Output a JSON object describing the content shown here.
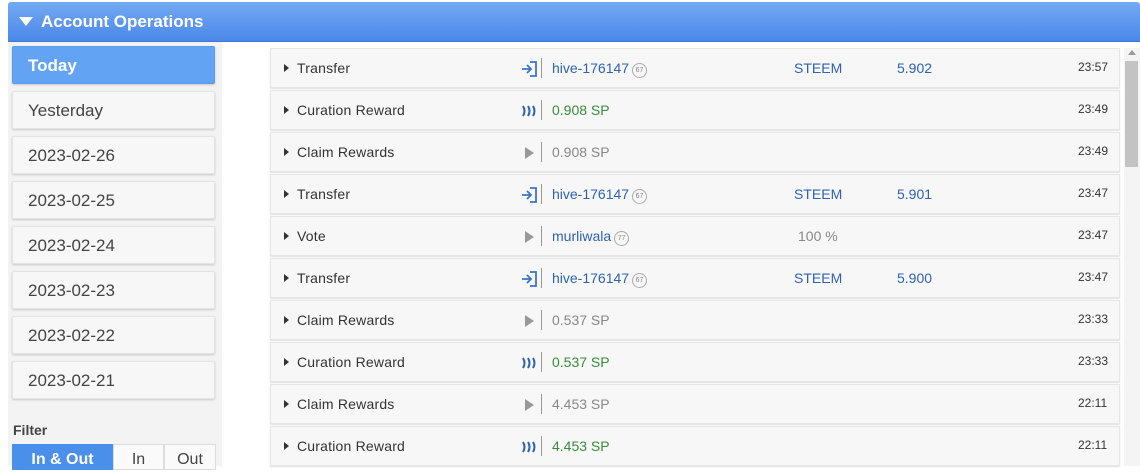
{
  "header": {
    "title": "Account Operations"
  },
  "days": [
    "Today",
    "Yesterday",
    "2023-02-26",
    "2023-02-25",
    "2023-02-24",
    "2023-02-23",
    "2023-02-22",
    "2023-02-21"
  ],
  "filter": {
    "label": "Filter",
    "options": [
      "In & Out",
      "In",
      "Out"
    ]
  },
  "operations": [
    {
      "type": "Transfer",
      "icon": "transfer-in-icon",
      "main": "hive-176147",
      "rep": "67",
      "asset": "STEEM",
      "amount": "5.902",
      "pct": "",
      "time": "23:57"
    },
    {
      "type": "Curation Reward",
      "icon": "steem-icon",
      "main": "0.908 SP",
      "rep": "",
      "asset": "",
      "amount": "",
      "pct": "",
      "time": "23:49"
    },
    {
      "type": "Claim Rewards",
      "icon": "play-icon",
      "main": "0.908 SP",
      "rep": "",
      "asset": "",
      "amount": "",
      "pct": "",
      "time": "23:49"
    },
    {
      "type": "Transfer",
      "icon": "transfer-in-icon",
      "main": "hive-176147",
      "rep": "67",
      "asset": "STEEM",
      "amount": "5.901",
      "pct": "",
      "time": "23:47"
    },
    {
      "type": "Vote",
      "icon": "play-icon",
      "main": "murliwala",
      "rep": "77",
      "asset": "",
      "amount": "",
      "pct": "100 %",
      "time": "23:47"
    },
    {
      "type": "Transfer",
      "icon": "transfer-in-icon",
      "main": "hive-176147",
      "rep": "67",
      "asset": "STEEM",
      "amount": "5.900",
      "pct": "",
      "time": "23:47"
    },
    {
      "type": "Claim Rewards",
      "icon": "play-icon",
      "main": "0.537 SP",
      "rep": "",
      "asset": "",
      "amount": "",
      "pct": "",
      "time": "23:33"
    },
    {
      "type": "Curation Reward",
      "icon": "steem-icon",
      "main": "0.537 SP",
      "rep": "",
      "asset": "",
      "amount": "",
      "pct": "",
      "time": "23:33"
    },
    {
      "type": "Claim Rewards",
      "icon": "play-icon",
      "main": "4.453 SP",
      "rep": "",
      "asset": "",
      "amount": "",
      "pct": "",
      "time": "22:11"
    },
    {
      "type": "Curation Reward",
      "icon": "steem-icon",
      "main": "4.453 SP",
      "rep": "",
      "asset": "",
      "amount": "",
      "pct": "",
      "time": "22:11"
    }
  ],
  "colors": {
    "header": "#4a87e8",
    "active": "#62a3f3",
    "link": "#2f62b3",
    "green": "#3a8b3a"
  }
}
